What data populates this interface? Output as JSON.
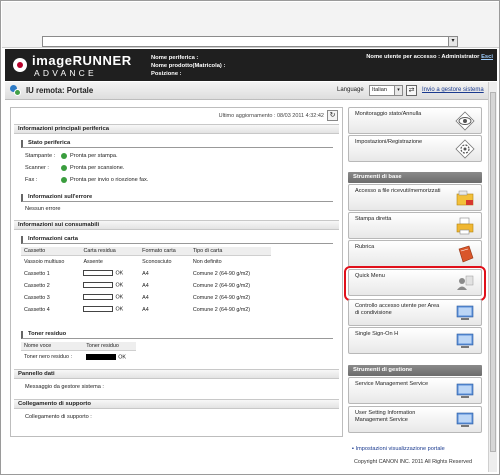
{
  "header": {
    "brand_line1": "imageRUNNER",
    "brand_line2": "ADVANCE",
    "device_name_label": "Nome periferica :",
    "product_name_label": "Nome prodotto(Matricola) :",
    "location_label": "Posizione :",
    "user_label": "Nome utente per accesso : Administrator",
    "logout_label": "Esci"
  },
  "titlebar": {
    "page_title": "IU remota: Portale",
    "language_label": "Language",
    "language_value": "Italian",
    "send_admin_label": "Invio a gestore sistema"
  },
  "main": {
    "last_update": "Ultimo aggiornamento : 08/03 2011 4:32:42",
    "sec_main_info": "Informazioni principali periferica",
    "sub_status": "Stato periferica",
    "status_rows": [
      {
        "label": "Stampante :",
        "value": "Pronta per stampa."
      },
      {
        "label": "Scanner :",
        "value": "Pronta per scansione."
      },
      {
        "label": "Fax :",
        "value": "Pronta per invio o ricezione fax."
      }
    ],
    "sub_errors": "Informazioni sull'errore",
    "no_errors": "Nessun errore",
    "sec_consumables": "Informazioni sui consumabili",
    "sub_paper": "Informazioni carta",
    "paper_headers": [
      "Cassetto",
      "Carta residua",
      "Formato carta",
      "Tipo di carta"
    ],
    "paper_rows": [
      {
        "drawer": "Vassoio multiuso",
        "residual": "Assente",
        "format": "Sconosciuto",
        "type": "Non definito",
        "bar": false
      },
      {
        "drawer": "Cassetto 1",
        "residual": "OK",
        "format": "A4",
        "type": "Comune 2 (64-90 g/m2)",
        "bar": true
      },
      {
        "drawer": "Cassetto 2",
        "residual": "OK",
        "format": "A4",
        "type": "Comune 2 (64-90 g/m2)",
        "bar": true
      },
      {
        "drawer": "Cassetto 3",
        "residual": "OK",
        "format": "A4",
        "type": "Comune 2 (64-90 g/m2)",
        "bar": true
      },
      {
        "drawer": "Cassetto 4",
        "residual": "OK",
        "format": "A4",
        "type": "Comune 2 (64-90 g/m2)",
        "bar": true
      }
    ],
    "sub_toner": "Toner residuo",
    "toner_headers": [
      "Nome voce",
      "Toner residuo"
    ],
    "toner_row": {
      "name": "Toner nero residuo :",
      "value": "OK"
    },
    "sec_board": "Pannello dati",
    "board_msg": "Messaggio da gestore sistema :",
    "sec_support": "Collegamento di supporto",
    "support_link": "Collegamento di supporto :"
  },
  "right": {
    "monitor": "Monitoraggio stato/Annulla",
    "settings": "Impostazioni/Registrazione",
    "basic_tools": "Strumenti di base",
    "access_files": "Accesso a file ricevuti/memorizzati",
    "direct_print": "Stampa diretta",
    "address_book": "Rubrica",
    "quick_menu": "Quick Menu",
    "access_control": "Controllo accesso utente per Area di condivisione",
    "sso": "Single Sign-On H",
    "mgmt_tools": "Strumenti di gestione",
    "sms": "Service Management Service",
    "usi": "User Setting Information Management Service",
    "portal_settings": "Impostazioni visualizzazione portale",
    "copyright": "Copyright CANON INC. 2011 All Rights Reserved"
  }
}
